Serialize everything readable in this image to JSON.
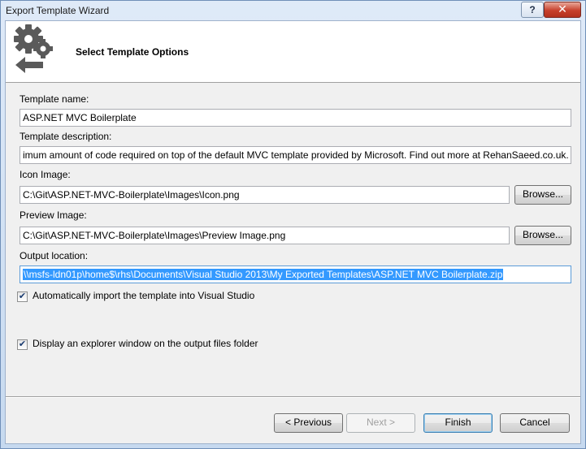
{
  "window": {
    "title": "Export Template Wizard",
    "help_label": "?",
    "close_label": "✕"
  },
  "header": {
    "title": "Select Template Options",
    "icon": "gear-icon"
  },
  "fields": {
    "template_name_label": "Template name:",
    "template_name_value": "ASP.NET MVC Boilerplate",
    "template_description_label": "Template description:",
    "template_description_value": "imum amount of code required on top of the default MVC template provided by Microsoft. Find out more at RehanSaeed.co.uk.",
    "icon_image_label": "Icon Image:",
    "icon_image_value": "C:\\Git\\ASP.NET-MVC-Boilerplate\\Images\\Icon.png",
    "preview_image_label": "Preview Image:",
    "preview_image_value": "C:\\Git\\ASP.NET-MVC-Boilerplate\\Images\\Preview Image.png",
    "output_location_label": "Output location:",
    "output_location_value": "\\\\msfs-ldn01p\\home$\\rhs\\Documents\\Visual Studio 2013\\My Exported Templates\\ASP.NET MVC Boilerplate.zip",
    "browse_label": "Browse..."
  },
  "options": {
    "auto_import_label": "Automatically import the template into Visual Studio",
    "auto_import_checked": true,
    "explorer_window_label": "Display an explorer window on the output files folder",
    "explorer_window_checked": true,
    "check_mark": "✔"
  },
  "buttons": {
    "previous": "< Previous",
    "next": "Next >",
    "finish": "Finish",
    "cancel": "Cancel"
  }
}
